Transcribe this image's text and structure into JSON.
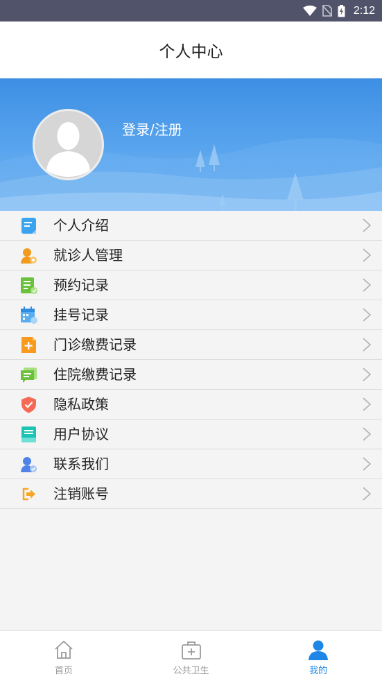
{
  "status_bar": {
    "time": "2:12"
  },
  "header": {
    "title": "个人中心"
  },
  "profile": {
    "login_label": "登录/注册"
  },
  "menu": [
    {
      "label": "个人介绍"
    },
    {
      "label": "就诊人管理"
    },
    {
      "label": "预约记录"
    },
    {
      "label": "挂号记录"
    },
    {
      "label": "门诊缴费记录"
    },
    {
      "label": "住院缴费记录"
    },
    {
      "label": "隐私政策"
    },
    {
      "label": "用户协议"
    },
    {
      "label": "联系我们"
    },
    {
      "label": "注销账号"
    }
  ],
  "tabbar": {
    "items": [
      {
        "label": "首页",
        "icon": "home-icon"
      },
      {
        "label": "公共卫生",
        "icon": "medical-kit-icon"
      },
      {
        "label": "我的",
        "icon": "user-icon"
      }
    ],
    "active_index": 2
  },
  "colors": {
    "accent": "#1e86e6",
    "banner": "#4a98e8",
    "status_bar": "#51536a"
  }
}
